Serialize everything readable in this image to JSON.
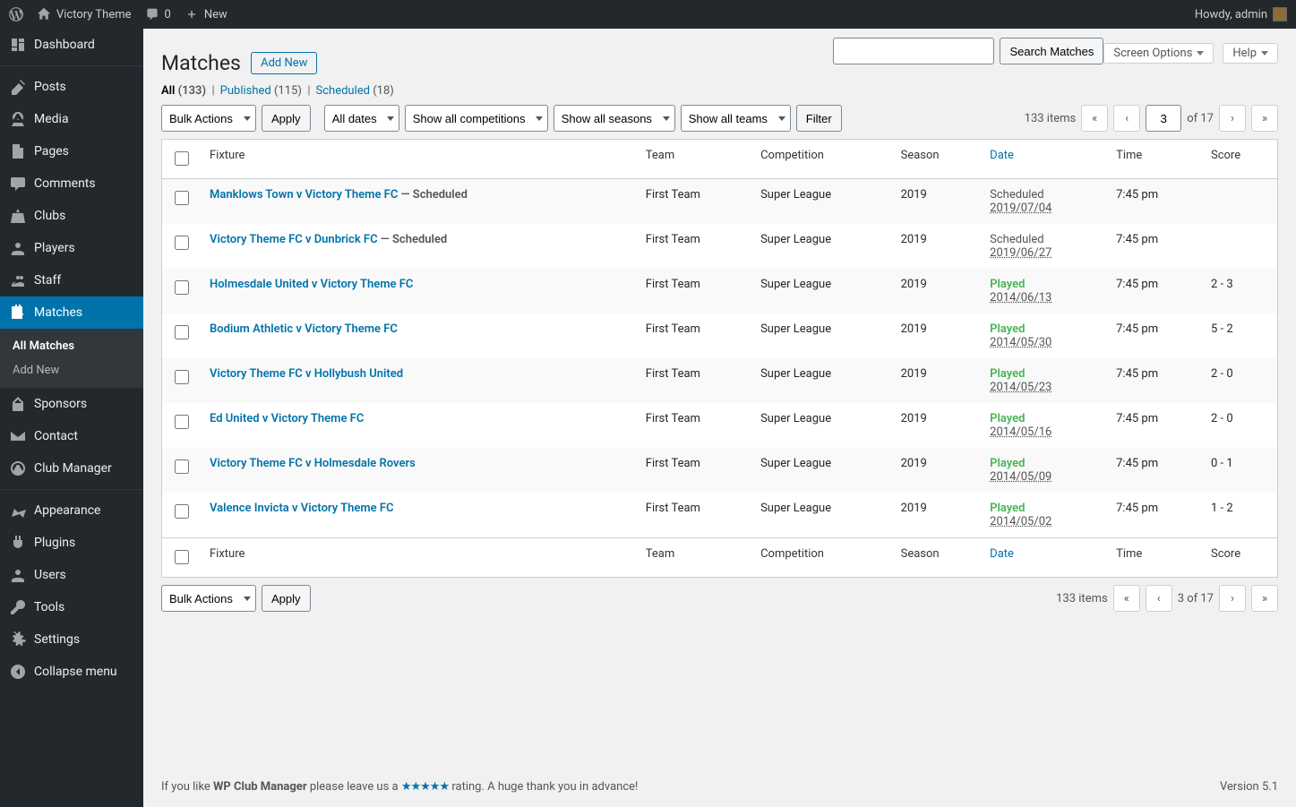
{
  "adminbar": {
    "site_name": "Victory Theme",
    "comments_count": "0",
    "new_label": "New",
    "greeting": "Howdy, admin"
  },
  "sidebar": {
    "items": [
      {
        "key": "dashboard",
        "label": "Dashboard"
      },
      {
        "key": "posts",
        "label": "Posts"
      },
      {
        "key": "media",
        "label": "Media"
      },
      {
        "key": "pages",
        "label": "Pages"
      },
      {
        "key": "comments",
        "label": "Comments"
      },
      {
        "key": "clubs",
        "label": "Clubs"
      },
      {
        "key": "players",
        "label": "Players"
      },
      {
        "key": "staff",
        "label": "Staff"
      },
      {
        "key": "matches",
        "label": "Matches"
      },
      {
        "key": "sponsors",
        "label": "Sponsors"
      },
      {
        "key": "contact",
        "label": "Contact"
      },
      {
        "key": "club-manager",
        "label": "Club Manager"
      },
      {
        "key": "appearance",
        "label": "Appearance"
      },
      {
        "key": "plugins",
        "label": "Plugins"
      },
      {
        "key": "users",
        "label": "Users"
      },
      {
        "key": "tools",
        "label": "Tools"
      },
      {
        "key": "settings",
        "label": "Settings"
      },
      {
        "key": "collapse",
        "label": "Collapse menu"
      }
    ],
    "submenu": {
      "all_matches": "All Matches",
      "add_new": "Add New"
    }
  },
  "screen": {
    "options": "Screen Options",
    "help": "Help"
  },
  "page": {
    "title": "Matches",
    "add_new": "Add New"
  },
  "filters": {
    "views": {
      "all_label": "All",
      "all_count": "(133)",
      "published_label": "Published",
      "published_count": "(115)",
      "scheduled_label": "Scheduled",
      "scheduled_count": "(18)"
    },
    "bulk_actions": "Bulk Actions",
    "apply": "Apply",
    "all_dates": "All dates",
    "all_competitions": "Show all competitions",
    "all_seasons": "Show all seasons",
    "all_teams": "Show all teams",
    "filter": "Filter",
    "search_button": "Search Matches"
  },
  "pagination": {
    "items_label": "133 items",
    "current": "3",
    "of_total": "of 17",
    "bottom_display": "3 of 17"
  },
  "columns": {
    "fixture": "Fixture",
    "team": "Team",
    "competition": "Competition",
    "season": "Season",
    "date": "Date",
    "time": "Time",
    "score": "Score"
  },
  "rows": [
    {
      "fixture": "Manklows Town v Victory Theme FC",
      "state": " — Scheduled",
      "team": "First Team",
      "comp": "Super League",
      "season": "2019",
      "status": "Scheduled",
      "status_class": "scheduled",
      "date": "2019/07/04",
      "time": "7:45 pm",
      "score": ""
    },
    {
      "fixture": "Victory Theme FC v Dunbrick FC",
      "state": " — Scheduled",
      "team": "First Team",
      "comp": "Super League",
      "season": "2019",
      "status": "Scheduled",
      "status_class": "scheduled",
      "date": "2019/06/27",
      "time": "7:45 pm",
      "score": ""
    },
    {
      "fixture": "Holmesdale United v Victory Theme FC",
      "state": "",
      "team": "First Team",
      "comp": "Super League",
      "season": "2019",
      "status": "Played",
      "status_class": "played",
      "date": "2014/06/13",
      "time": "7:45 pm",
      "score": "2 - 3"
    },
    {
      "fixture": "Bodium Athletic v Victory Theme FC",
      "state": "",
      "team": "First Team",
      "comp": "Super League",
      "season": "2019",
      "status": "Played",
      "status_class": "played",
      "date": "2014/05/30",
      "time": "7:45 pm",
      "score": "5 - 2"
    },
    {
      "fixture": "Victory Theme FC v Hollybush United",
      "state": "",
      "team": "First Team",
      "comp": "Super League",
      "season": "2019",
      "status": "Played",
      "status_class": "played",
      "date": "2014/05/23",
      "time": "7:45 pm",
      "score": "2 - 0"
    },
    {
      "fixture": "Ed United v Victory Theme FC",
      "state": "",
      "team": "First Team",
      "comp": "Super League",
      "season": "2019",
      "status": "Played",
      "status_class": "played",
      "date": "2014/05/16",
      "time": "7:45 pm",
      "score": "2 - 0"
    },
    {
      "fixture": "Victory Theme FC v Holmesdale Rovers",
      "state": "",
      "team": "First Team",
      "comp": "Super League",
      "season": "2019",
      "status": "Played",
      "status_class": "played",
      "date": "2014/05/09",
      "time": "7:45 pm",
      "score": "0 - 1"
    },
    {
      "fixture": "Valence Invicta v Victory Theme FC",
      "state": "",
      "team": "First Team",
      "comp": "Super League",
      "season": "2019",
      "status": "Played",
      "status_class": "played",
      "date": "2014/05/02",
      "time": "7:45 pm",
      "score": "1 - 2"
    }
  ],
  "footer": {
    "prefix": "If you like ",
    "brand": "WP Club Manager",
    "mid": " please leave us a ",
    "suffix": " rating. A huge thank you in advance!",
    "version": "Version 5.1"
  }
}
